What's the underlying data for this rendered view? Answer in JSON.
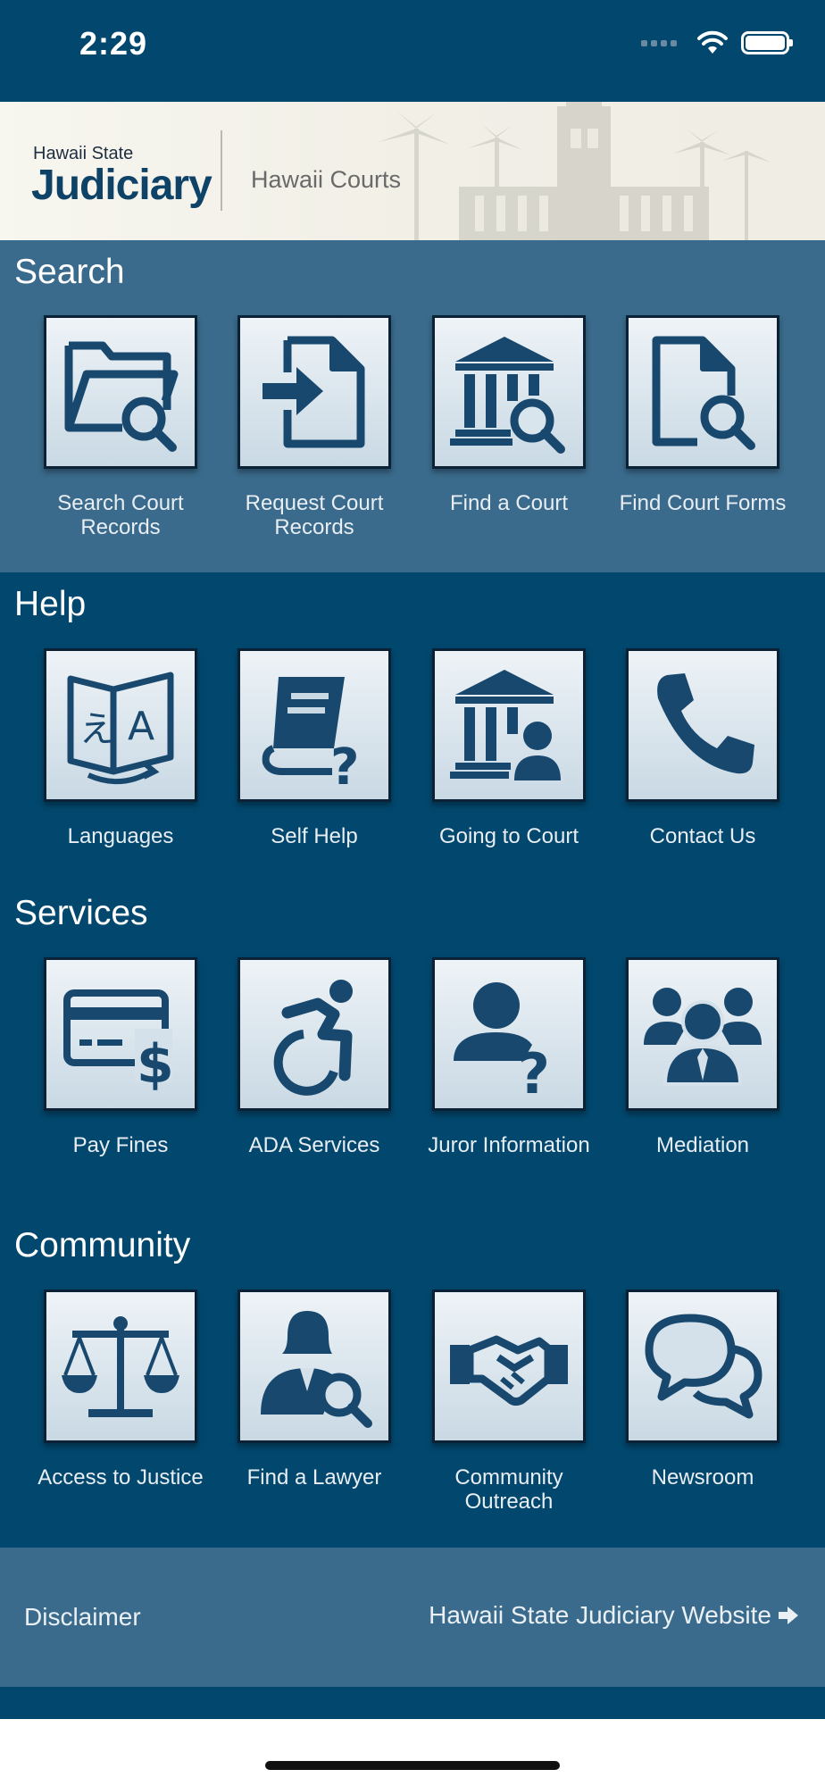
{
  "status_bar": {
    "time": "2:29"
  },
  "header": {
    "logo_line1": "Hawaii State",
    "logo_line2": "Judiciary",
    "subtitle": "Hawaii Courts"
  },
  "sections": {
    "search": {
      "title": "Search",
      "items": [
        {
          "label": "Search Court Records",
          "icon": "folder-search-icon"
        },
        {
          "label": "Request Court Records",
          "icon": "document-import-icon"
        },
        {
          "label": "Find a Court",
          "icon": "courthouse-search-icon"
        },
        {
          "label": "Find Court Forms",
          "icon": "document-search-icon"
        }
      ]
    },
    "help": {
      "title": "Help",
      "items": [
        {
          "label": "Languages",
          "icon": "translate-icon"
        },
        {
          "label": "Self Help",
          "icon": "book-question-icon"
        },
        {
          "label": "Going to Court",
          "icon": "courthouse-person-icon"
        },
        {
          "label": "Contact Us",
          "icon": "phone-icon"
        }
      ]
    },
    "services": {
      "title": "Services",
      "items": [
        {
          "label": "Pay Fines",
          "icon": "credit-card-dollar-icon"
        },
        {
          "label": "ADA Services",
          "icon": "accessibility-icon"
        },
        {
          "label": "Juror Information",
          "icon": "person-question-icon"
        },
        {
          "label": "Mediation",
          "icon": "group-icon"
        }
      ]
    },
    "community": {
      "title": "Community",
      "items": [
        {
          "label": "Access to Justice",
          "icon": "scales-icon"
        },
        {
          "label": "Find a Lawyer",
          "icon": "lawyer-search-icon"
        },
        {
          "label": "Community Outreach",
          "icon": "handshake-icon"
        },
        {
          "label": "Newsroom",
          "icon": "chat-bubbles-icon"
        }
      ]
    }
  },
  "footer": {
    "disclaimer": "Disclaimer",
    "website_link": "Hawaii State Judiciary Website"
  },
  "colors": {
    "primary": "#02476d",
    "section_search_bg": "#3a6b8c",
    "icon": "#19486f",
    "tile_top": "#eef3f7",
    "tile_bottom": "#c9d9e4"
  }
}
